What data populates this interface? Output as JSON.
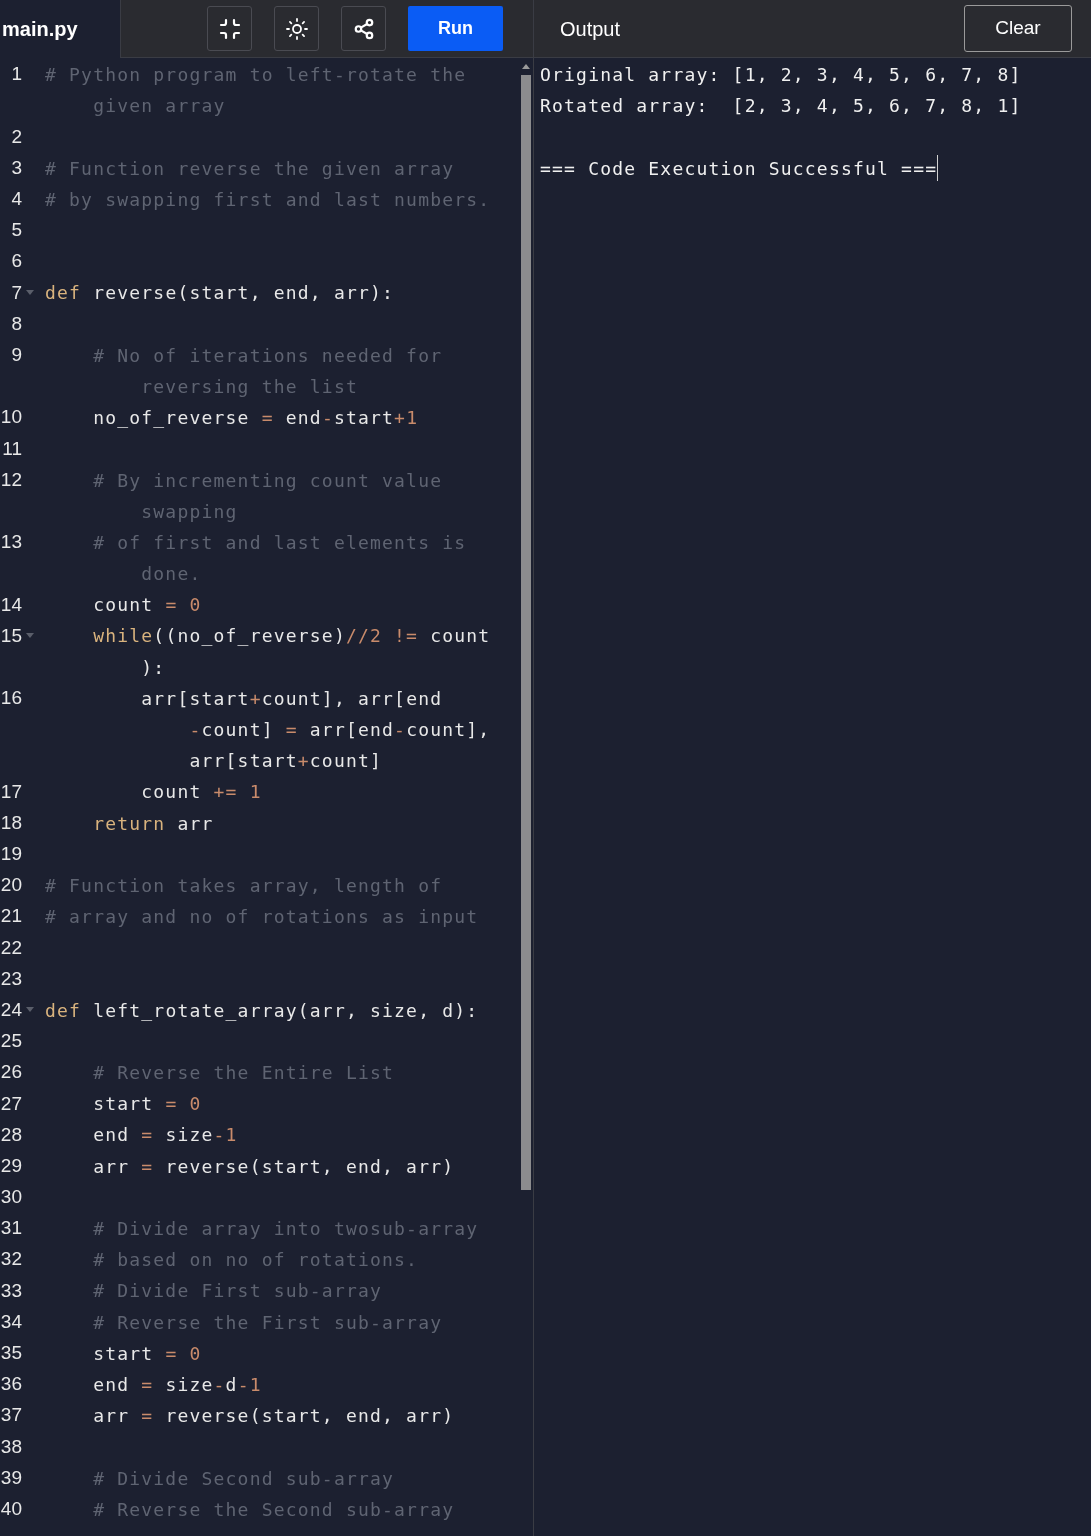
{
  "editor": {
    "filename": "main.py",
    "run_label": "Run",
    "lines": [
      {
        "number": "1",
        "fold": false,
        "rows": [
          {
            "tokens": [
              {
                "kind": "comment",
                "text": "# Python program to left-rotate the"
              }
            ]
          },
          {
            "tokens": [
              {
                "kind": "comment",
                "text": "    given array"
              }
            ]
          }
        ]
      },
      {
        "number": "2",
        "fold": false,
        "rows": [
          {
            "tokens": []
          }
        ]
      },
      {
        "number": "3",
        "fold": false,
        "rows": [
          {
            "tokens": [
              {
                "kind": "comment",
                "text": "# Function reverse the given array"
              }
            ]
          }
        ]
      },
      {
        "number": "4",
        "fold": false,
        "rows": [
          {
            "tokens": [
              {
                "kind": "comment",
                "text": "# by swapping first and last numbers."
              }
            ]
          }
        ]
      },
      {
        "number": "5",
        "fold": false,
        "rows": [
          {
            "tokens": []
          }
        ]
      },
      {
        "number": "6",
        "fold": false,
        "rows": [
          {
            "tokens": []
          }
        ]
      },
      {
        "number": "7",
        "fold": true,
        "rows": [
          {
            "tokens": [
              {
                "kind": "keyword",
                "text": "def"
              },
              {
                "kind": "plain",
                "text": " reverse(start, end, arr):"
              }
            ]
          }
        ]
      },
      {
        "number": "8",
        "fold": false,
        "rows": [
          {
            "tokens": []
          }
        ]
      },
      {
        "number": "9",
        "fold": false,
        "rows": [
          {
            "tokens": [
              {
                "kind": "comment",
                "text": "    # No of iterations needed for"
              }
            ]
          },
          {
            "tokens": [
              {
                "kind": "comment",
                "text": "        reversing the list"
              }
            ]
          }
        ]
      },
      {
        "number": "10",
        "fold": false,
        "rows": [
          {
            "tokens": [
              {
                "kind": "plain",
                "text": "    no_of_reverse "
              },
              {
                "kind": "operator",
                "text": "="
              },
              {
                "kind": "plain",
                "text": " end"
              },
              {
                "kind": "operator",
                "text": "-"
              },
              {
                "kind": "plain",
                "text": "start"
              },
              {
                "kind": "operator",
                "text": "+1"
              }
            ]
          }
        ]
      },
      {
        "number": "11",
        "fold": false,
        "rows": [
          {
            "tokens": []
          }
        ]
      },
      {
        "number": "12",
        "fold": false,
        "rows": [
          {
            "tokens": [
              {
                "kind": "comment",
                "text": "    # By incrementing count value"
              }
            ]
          },
          {
            "tokens": [
              {
                "kind": "comment",
                "text": "        swapping"
              }
            ]
          }
        ]
      },
      {
        "number": "13",
        "fold": false,
        "rows": [
          {
            "tokens": [
              {
                "kind": "comment",
                "text": "    # of first and last elements is"
              }
            ]
          },
          {
            "tokens": [
              {
                "kind": "comment",
                "text": "        done."
              }
            ]
          }
        ]
      },
      {
        "number": "14",
        "fold": false,
        "rows": [
          {
            "tokens": [
              {
                "kind": "plain",
                "text": "    count "
              },
              {
                "kind": "operator",
                "text": "= 0"
              }
            ]
          }
        ]
      },
      {
        "number": "15",
        "fold": true,
        "rows": [
          {
            "tokens": [
              {
                "kind": "keyword",
                "text": "    while"
              },
              {
                "kind": "plain",
                "text": "((no_of_reverse)"
              },
              {
                "kind": "operator",
                "text": "//2 !="
              },
              {
                "kind": "plain",
                "text": " count"
              }
            ]
          },
          {
            "tokens": [
              {
                "kind": "plain",
                "text": "        ):"
              }
            ]
          }
        ]
      },
      {
        "number": "16",
        "fold": false,
        "rows": [
          {
            "tokens": [
              {
                "kind": "plain",
                "text": "        arr[start"
              },
              {
                "kind": "operator",
                "text": "+"
              },
              {
                "kind": "plain",
                "text": "count], arr[end"
              }
            ]
          },
          {
            "tokens": [
              {
                "kind": "operator",
                "text": "            -"
              },
              {
                "kind": "plain",
                "text": "count] "
              },
              {
                "kind": "operator",
                "text": "="
              },
              {
                "kind": "plain",
                "text": " arr[end"
              },
              {
                "kind": "operator",
                "text": "-"
              },
              {
                "kind": "plain",
                "text": "count],"
              }
            ]
          },
          {
            "tokens": [
              {
                "kind": "plain",
                "text": "            arr[start"
              },
              {
                "kind": "operator",
                "text": "+"
              },
              {
                "kind": "plain",
                "text": "count]"
              }
            ]
          }
        ]
      },
      {
        "number": "17",
        "fold": false,
        "rows": [
          {
            "tokens": [
              {
                "kind": "plain",
                "text": "        count "
              },
              {
                "kind": "operator",
                "text": "+= 1"
              }
            ]
          }
        ]
      },
      {
        "number": "18",
        "fold": false,
        "rows": [
          {
            "tokens": [
              {
                "kind": "keyword",
                "text": "    return"
              },
              {
                "kind": "plain",
                "text": " arr"
              }
            ]
          }
        ]
      },
      {
        "number": "19",
        "fold": false,
        "rows": [
          {
            "tokens": []
          }
        ]
      },
      {
        "number": "20",
        "fold": false,
        "rows": [
          {
            "tokens": [
              {
                "kind": "comment",
                "text": "# Function takes array, length of"
              }
            ]
          }
        ]
      },
      {
        "number": "21",
        "fold": false,
        "rows": [
          {
            "tokens": [
              {
                "kind": "comment",
                "text": "# array and no of rotations as input"
              }
            ]
          }
        ]
      },
      {
        "number": "22",
        "fold": false,
        "rows": [
          {
            "tokens": []
          }
        ]
      },
      {
        "number": "23",
        "fold": false,
        "rows": [
          {
            "tokens": []
          }
        ]
      },
      {
        "number": "24",
        "fold": true,
        "rows": [
          {
            "tokens": [
              {
                "kind": "keyword",
                "text": "def"
              },
              {
                "kind": "plain",
                "text": " left_rotate_array(arr, size, d):"
              }
            ]
          }
        ]
      },
      {
        "number": "25",
        "fold": false,
        "rows": [
          {
            "tokens": []
          }
        ]
      },
      {
        "number": "26",
        "fold": false,
        "rows": [
          {
            "tokens": [
              {
                "kind": "comment",
                "text": "    # Reverse the Entire List"
              }
            ]
          }
        ]
      },
      {
        "number": "27",
        "fold": false,
        "rows": [
          {
            "tokens": [
              {
                "kind": "plain",
                "text": "    start "
              },
              {
                "kind": "operator",
                "text": "= 0"
              }
            ]
          }
        ]
      },
      {
        "number": "28",
        "fold": false,
        "rows": [
          {
            "tokens": [
              {
                "kind": "plain",
                "text": "    end "
              },
              {
                "kind": "operator",
                "text": "="
              },
              {
                "kind": "plain",
                "text": " size"
              },
              {
                "kind": "operator",
                "text": "-1"
              }
            ]
          }
        ]
      },
      {
        "number": "29",
        "fold": false,
        "rows": [
          {
            "tokens": [
              {
                "kind": "plain",
                "text": "    arr "
              },
              {
                "kind": "operator",
                "text": "="
              },
              {
                "kind": "plain",
                "text": " reverse(start, end, arr)"
              }
            ]
          }
        ]
      },
      {
        "number": "30",
        "fold": false,
        "rows": [
          {
            "tokens": []
          }
        ]
      },
      {
        "number": "31",
        "fold": false,
        "rows": [
          {
            "tokens": [
              {
                "kind": "comment",
                "text": "    # Divide array into twosub-array"
              }
            ]
          }
        ]
      },
      {
        "number": "32",
        "fold": false,
        "rows": [
          {
            "tokens": [
              {
                "kind": "comment",
                "text": "    # based on no of rotations."
              }
            ]
          }
        ]
      },
      {
        "number": "33",
        "fold": false,
        "rows": [
          {
            "tokens": [
              {
                "kind": "comment",
                "text": "    # Divide First sub-array"
              }
            ]
          }
        ]
      },
      {
        "number": "34",
        "fold": false,
        "rows": [
          {
            "tokens": [
              {
                "kind": "comment",
                "text": "    # Reverse the First sub-array"
              }
            ]
          }
        ]
      },
      {
        "number": "35",
        "fold": false,
        "rows": [
          {
            "tokens": [
              {
                "kind": "plain",
                "text": "    start "
              },
              {
                "kind": "operator",
                "text": "= 0"
              }
            ]
          }
        ]
      },
      {
        "number": "36",
        "fold": false,
        "rows": [
          {
            "tokens": [
              {
                "kind": "plain",
                "text": "    end "
              },
              {
                "kind": "operator",
                "text": "="
              },
              {
                "kind": "plain",
                "text": " size"
              },
              {
                "kind": "operator",
                "text": "-"
              },
              {
                "kind": "plain",
                "text": "d"
              },
              {
                "kind": "operator",
                "text": "-1"
              }
            ]
          }
        ]
      },
      {
        "number": "37",
        "fold": false,
        "rows": [
          {
            "tokens": [
              {
                "kind": "plain",
                "text": "    arr "
              },
              {
                "kind": "operator",
                "text": "="
              },
              {
                "kind": "plain",
                "text": " reverse(start, end, arr)"
              }
            ]
          }
        ]
      },
      {
        "number": "38",
        "fold": false,
        "rows": [
          {
            "tokens": []
          }
        ]
      },
      {
        "number": "39",
        "fold": false,
        "rows": [
          {
            "tokens": [
              {
                "kind": "comment",
                "text": "    # Divide Second sub-array"
              }
            ]
          }
        ]
      },
      {
        "number": "40",
        "fold": false,
        "rows": [
          {
            "tokens": [
              {
                "kind": "comment",
                "text": "    # Reverse the Second sub-array"
              }
            ]
          }
        ]
      }
    ]
  },
  "output": {
    "title": "Output",
    "clear_label": "Clear",
    "lines": [
      "Original array: [1, 2, 3, 4, 5, 6, 7, 8]",
      "Rotated array:  [2, 3, 4, 5, 6, 7, 8, 1]"
    ],
    "status": "=== Code Execution Successful ==="
  }
}
